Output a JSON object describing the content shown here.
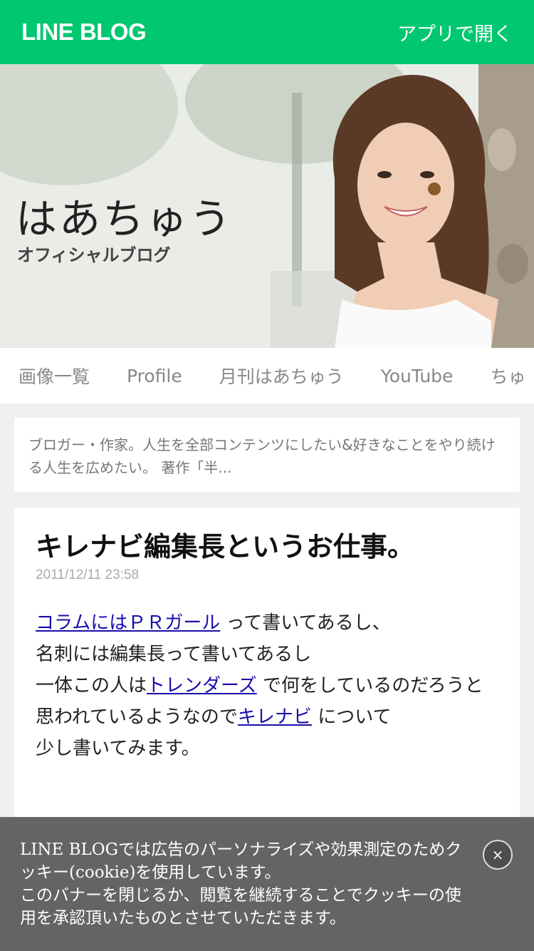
{
  "header": {
    "logo": "LINE BLOG",
    "open_app_label": "アプリで開く"
  },
  "hero": {
    "title": "はあちゅう",
    "subtitle": "オフィシャルブログ"
  },
  "tabs": [
    {
      "label": "画像一覧"
    },
    {
      "label": "Profile"
    },
    {
      "label": "月刊はあちゅう"
    },
    {
      "label": "YouTube"
    },
    {
      "label": "ちゅ"
    }
  ],
  "profile": {
    "description": "ブロガー・作家。人生を全部コンテンツにしたい&好きなことをやり続ける人生を広めたい。 著作「半..."
  },
  "article": {
    "title": "キレナビ編集長というお仕事。",
    "date": "2011/12/11 23:58",
    "link_pr_girl": "コラムにはＰＲガール",
    "text_1": " って書いてあるし、",
    "text_2": "名刺には編集長って書いてあるし",
    "text_3": "一体この人は",
    "link_trenders": "トレンダーズ",
    "text_4": " で何をしているのだろうと",
    "text_5": "思われているようなので",
    "link_kirenavi": "キレナビ",
    "text_6": " について",
    "text_7": "少し書いてみます。"
  },
  "cookie_banner": {
    "line_1": "LINE BLOGでは広告のパーソナライズや効果測定のためクッキー(cookie)を使用しています。",
    "line_2": "このバナーを閉じるか、閲覧を継続することでクッキーの使用を承認頂いたものとさせていただきます。",
    "close_label": "×"
  },
  "colors": {
    "brand_green": "#00c770",
    "link": "#1a0dab"
  }
}
